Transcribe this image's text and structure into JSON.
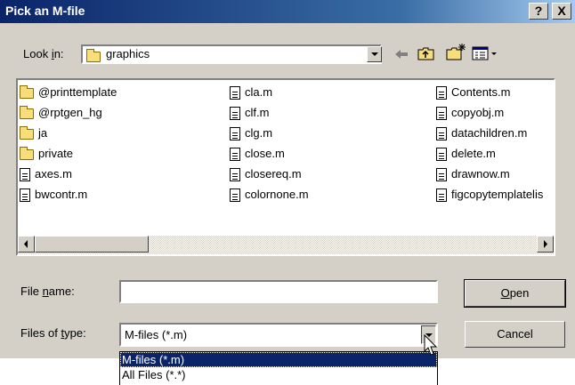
{
  "dialog": {
    "title": "Pick an M-file",
    "help_button": "?",
    "close_button": "X"
  },
  "lookin": {
    "label_pre": "Look ",
    "label_key": "i",
    "label_post": "n:",
    "value": "graphics"
  },
  "files": {
    "col1": [
      {
        "name": "@printtemplate",
        "type": "folder"
      },
      {
        "name": "@rptgen_hg",
        "type": "folder"
      },
      {
        "name": "ja",
        "type": "folder"
      },
      {
        "name": "private",
        "type": "folder"
      },
      {
        "name": "axes.m",
        "type": "file"
      },
      {
        "name": "bwcontr.m",
        "type": "file"
      }
    ],
    "col2": [
      {
        "name": "cla.m",
        "type": "file"
      },
      {
        "name": "clf.m",
        "type": "file"
      },
      {
        "name": "clg.m",
        "type": "file"
      },
      {
        "name": "close.m",
        "type": "file"
      },
      {
        "name": "closereq.m",
        "type": "file"
      },
      {
        "name": "colornone.m",
        "type": "file"
      }
    ],
    "col3": [
      {
        "name": "Contents.m",
        "type": "file"
      },
      {
        "name": "copyobj.m",
        "type": "file"
      },
      {
        "name": "datachildren.m",
        "type": "file"
      },
      {
        "name": "delete.m",
        "type": "file"
      },
      {
        "name": "drawnow.m",
        "type": "file"
      },
      {
        "name": "figcopytemplatelis",
        "type": "file"
      }
    ]
  },
  "filename": {
    "label_pre": "File ",
    "label_key": "n",
    "label_post": "ame:",
    "value": ""
  },
  "filetype": {
    "label_pre": "Files of ",
    "label_key": "t",
    "label_post": "ype:",
    "value": "M-files (*.m)",
    "options": [
      "M-files (*.m)",
      "All Files (*.*)"
    ]
  },
  "buttons": {
    "open_key": "O",
    "open_rest": "pen",
    "cancel": "Cancel"
  }
}
